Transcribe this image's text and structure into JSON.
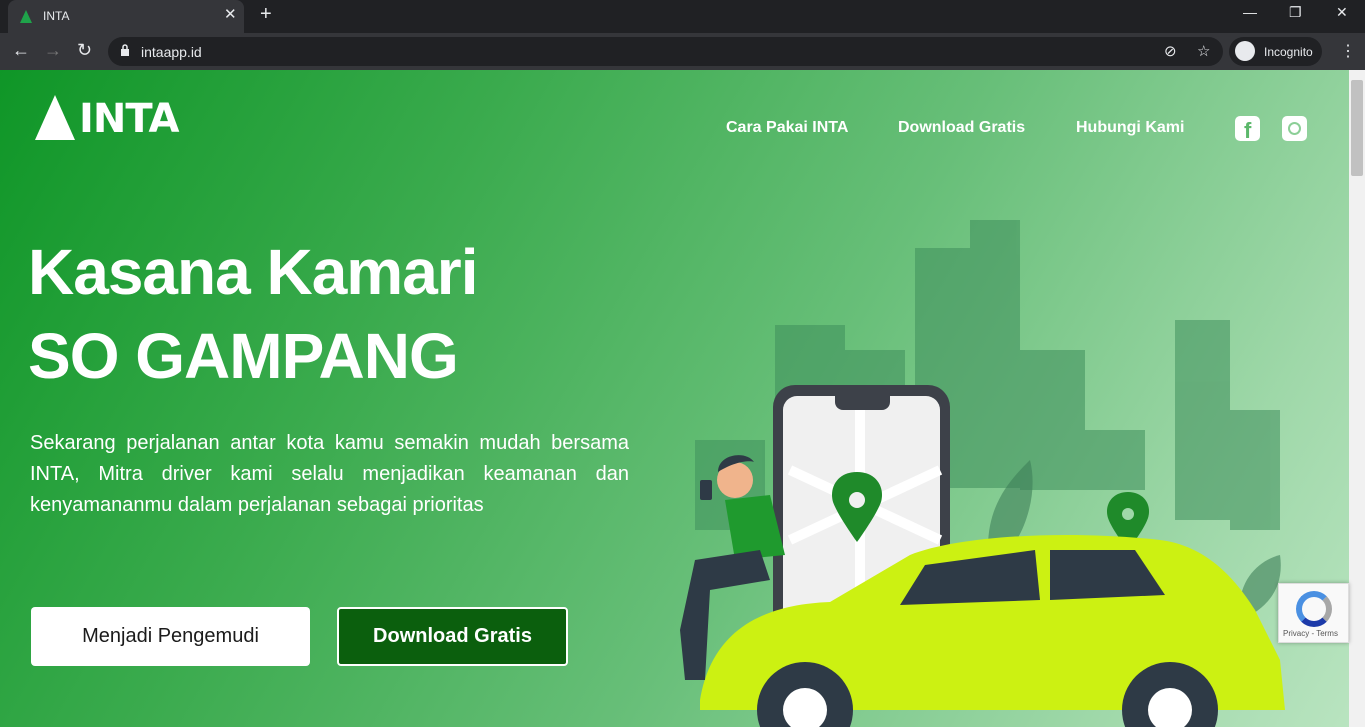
{
  "browser": {
    "tab_title": "INTA",
    "tab_close": "✕",
    "new_tab": "+",
    "url": "intaapp.id",
    "incognito_label": "Incognito",
    "window_min": "—",
    "window_max": "❐",
    "window_close": "✕"
  },
  "site": {
    "logo_text": "INTA",
    "nav": [
      "Cara Pakai INTA",
      "Download Gratis",
      "Hubungi Kami"
    ],
    "social_icons": [
      "facebook-icon",
      "instagram-icon"
    ]
  },
  "hero": {
    "title_line1": "Kasana Kamari",
    "title_line2": "SO GAMPANG",
    "body": "Sekarang perjalanan antar kota kamu semakin mudah bersama INTA, Mitra driver kami selalu menjadikan keamanan dan kenyamananmu dalam perjalanan sebagai prioritas",
    "cta_primary": "Menjadi Pengemudi",
    "cta_secondary": "Download Gratis"
  },
  "recaptcha": {
    "text": "Privacy - Terms"
  },
  "colors": {
    "brand_green": "#0f9627",
    "button_dark_green": "#0b5f0d",
    "car_lime": "#ccf112"
  }
}
